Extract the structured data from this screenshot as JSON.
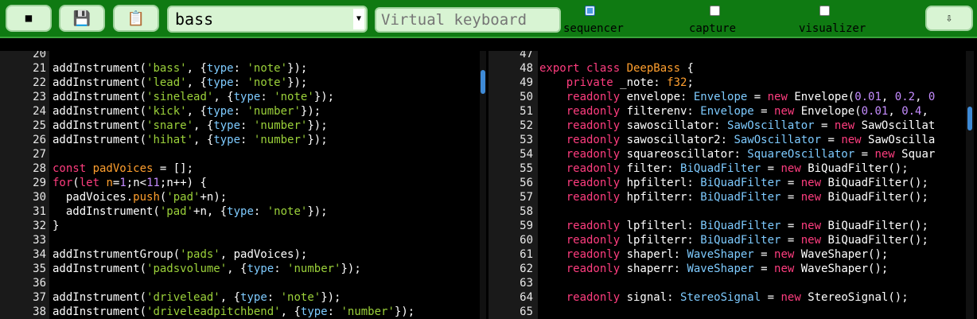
{
  "toolbar": {
    "stop_icon": "■",
    "save_icon": "💾",
    "copy_icon": "📋",
    "instrument_selected": "bass",
    "virtual_keyboard_placeholder": "Virtual keyboard",
    "checkboxes": [
      {
        "label": "sequencer",
        "checked": true
      },
      {
        "label": "capture",
        "checked": false
      },
      {
        "label": "visualizer",
        "checked": false
      }
    ],
    "download_icon": "⇩"
  },
  "left_code": [
    {
      "n": "20",
      "t": []
    },
    {
      "n": "21",
      "t": [
        [
          "t",
          "addInstrument("
        ],
        [
          "s",
          "'bass'"
        ],
        [
          "t",
          ", {"
        ],
        [
          "p",
          "type"
        ],
        [
          "t",
          ": "
        ],
        [
          "s",
          "'note'"
        ],
        [
          "t",
          "});"
        ]
      ]
    },
    {
      "n": "22",
      "t": [
        [
          "t",
          "addInstrument("
        ],
        [
          "s",
          "'lead'"
        ],
        [
          "t",
          ", {"
        ],
        [
          "p",
          "type"
        ],
        [
          "t",
          ": "
        ],
        [
          "s",
          "'note'"
        ],
        [
          "t",
          "});"
        ]
      ]
    },
    {
      "n": "23",
      "t": [
        [
          "t",
          "addInstrument("
        ],
        [
          "s",
          "'sinelead'"
        ],
        [
          "t",
          ", {"
        ],
        [
          "p",
          "type"
        ],
        [
          "t",
          ": "
        ],
        [
          "s",
          "'note'"
        ],
        [
          "t",
          "});"
        ]
      ]
    },
    {
      "n": "24",
      "t": [
        [
          "t",
          "addInstrument("
        ],
        [
          "s",
          "'kick'"
        ],
        [
          "t",
          ", {"
        ],
        [
          "p",
          "type"
        ],
        [
          "t",
          ": "
        ],
        [
          "s",
          "'number'"
        ],
        [
          "t",
          "});"
        ]
      ]
    },
    {
      "n": "25",
      "t": [
        [
          "t",
          "addInstrument("
        ],
        [
          "s",
          "'snare'"
        ],
        [
          "t",
          ", {"
        ],
        [
          "p",
          "type"
        ],
        [
          "t",
          ": "
        ],
        [
          "s",
          "'number'"
        ],
        [
          "t",
          "});"
        ]
      ]
    },
    {
      "n": "26",
      "t": [
        [
          "t",
          "addInstrument("
        ],
        [
          "s",
          "'hihat'"
        ],
        [
          "t",
          ", {"
        ],
        [
          "p",
          "type"
        ],
        [
          "t",
          ": "
        ],
        [
          "s",
          "'number'"
        ],
        [
          "t",
          "});"
        ]
      ]
    },
    {
      "n": "27",
      "t": []
    },
    {
      "n": "28",
      "t": [
        [
          "k",
          "const "
        ],
        [
          "c",
          "padVoices"
        ],
        [
          "t",
          " = [];"
        ]
      ]
    },
    {
      "n": "29",
      "t": [
        [
          "k",
          "for"
        ],
        [
          "t",
          "("
        ],
        [
          "k",
          "let "
        ],
        [
          "c",
          "n"
        ],
        [
          "t",
          "="
        ],
        [
          "n",
          "1"
        ],
        [
          "t",
          ";n<"
        ],
        [
          "n",
          "11"
        ],
        [
          "t",
          ";n++) {"
        ]
      ]
    },
    {
      "n": "30",
      "t": [
        [
          "t",
          "  padVoices."
        ],
        [
          "c",
          "push"
        ],
        [
          "t",
          "("
        ],
        [
          "s",
          "'pad'"
        ],
        [
          "t",
          "+n);"
        ]
      ]
    },
    {
      "n": "31",
      "t": [
        [
          "t",
          "  addInstrument("
        ],
        [
          "s",
          "'pad'"
        ],
        [
          "t",
          "+n, {"
        ],
        [
          "p",
          "type"
        ],
        [
          "t",
          ": "
        ],
        [
          "s",
          "'note'"
        ],
        [
          "t",
          "});"
        ]
      ]
    },
    {
      "n": "32",
      "t": [
        [
          "t",
          "}"
        ]
      ]
    },
    {
      "n": "33",
      "t": []
    },
    {
      "n": "34",
      "t": [
        [
          "t",
          "addInstrumentGroup("
        ],
        [
          "s",
          "'pads'"
        ],
        [
          "t",
          ", padVoices);"
        ]
      ]
    },
    {
      "n": "35",
      "t": [
        [
          "t",
          "addInstrument("
        ],
        [
          "s",
          "'padsvolume'"
        ],
        [
          "t",
          ", {"
        ],
        [
          "p",
          "type"
        ],
        [
          "t",
          ": "
        ],
        [
          "s",
          "'number'"
        ],
        [
          "t",
          "});"
        ]
      ]
    },
    {
      "n": "36",
      "t": []
    },
    {
      "n": "37",
      "t": [
        [
          "t",
          "addInstrument("
        ],
        [
          "s",
          "'drivelead'"
        ],
        [
          "t",
          ", {"
        ],
        [
          "p",
          "type"
        ],
        [
          "t",
          ": "
        ],
        [
          "s",
          "'note'"
        ],
        [
          "t",
          "});"
        ]
      ]
    },
    {
      "n": "38",
      "t": [
        [
          "t",
          "addInstrument("
        ],
        [
          "s",
          "'driveleadpitchbend'"
        ],
        [
          "t",
          ", {"
        ],
        [
          "p",
          "type"
        ],
        [
          "t",
          ": "
        ],
        [
          "s",
          "'number'"
        ],
        [
          "t",
          "});"
        ]
      ]
    }
  ],
  "right_code": [
    {
      "n": "47",
      "t": []
    },
    {
      "n": "48",
      "t": [
        [
          "k",
          "export class "
        ],
        [
          "c",
          "DeepBass"
        ],
        [
          "t",
          " {"
        ]
      ]
    },
    {
      "n": "49",
      "t": [
        [
          "k",
          "    private "
        ],
        [
          "t",
          "_note: "
        ],
        [
          "c",
          "f32"
        ],
        [
          "t",
          ";"
        ]
      ]
    },
    {
      "n": "50",
      "t": [
        [
          "k",
          "    readonly "
        ],
        [
          "t",
          "envelope: "
        ],
        [
          "p",
          "Envelope"
        ],
        [
          "t",
          " = "
        ],
        [
          "k",
          "new "
        ],
        [
          "t",
          "Envelope("
        ],
        [
          "n",
          "0.01"
        ],
        [
          "t",
          ", "
        ],
        [
          "n",
          "0.2"
        ],
        [
          "t",
          ", "
        ],
        [
          "n",
          "0"
        ]
      ]
    },
    {
      "n": "51",
      "t": [
        [
          "k",
          "    readonly "
        ],
        [
          "t",
          "filterenv: "
        ],
        [
          "p",
          "Envelope"
        ],
        [
          "t",
          " = "
        ],
        [
          "k",
          "new "
        ],
        [
          "t",
          "Envelope("
        ],
        [
          "n",
          "0.01"
        ],
        [
          "t",
          ", "
        ],
        [
          "n",
          "0.4"
        ],
        [
          "t",
          ","
        ]
      ]
    },
    {
      "n": "52",
      "t": [
        [
          "k",
          "    readonly "
        ],
        [
          "t",
          "sawoscillator: "
        ],
        [
          "p",
          "SawOscillator"
        ],
        [
          "t",
          " = "
        ],
        [
          "k",
          "new "
        ],
        [
          "t",
          "SawOscillat"
        ]
      ]
    },
    {
      "n": "53",
      "t": [
        [
          "k",
          "    readonly "
        ],
        [
          "t",
          "sawoscillator2: "
        ],
        [
          "p",
          "SawOscillator"
        ],
        [
          "t",
          " = "
        ],
        [
          "k",
          "new "
        ],
        [
          "t",
          "SawOscilla"
        ]
      ]
    },
    {
      "n": "54",
      "t": [
        [
          "k",
          "    readonly "
        ],
        [
          "t",
          "squareoscillator: "
        ],
        [
          "p",
          "SquareOscillator"
        ],
        [
          "t",
          " = "
        ],
        [
          "k",
          "new "
        ],
        [
          "t",
          "Squar"
        ]
      ]
    },
    {
      "n": "55",
      "t": [
        [
          "k",
          "    readonly "
        ],
        [
          "t",
          "filter: "
        ],
        [
          "p",
          "BiQuadFilter"
        ],
        [
          "t",
          " = "
        ],
        [
          "k",
          "new "
        ],
        [
          "t",
          "BiQuadFilter();"
        ]
      ]
    },
    {
      "n": "56",
      "t": [
        [
          "k",
          "    readonly "
        ],
        [
          "t",
          "hpfilterl: "
        ],
        [
          "p",
          "BiQuadFilter"
        ],
        [
          "t",
          " = "
        ],
        [
          "k",
          "new "
        ],
        [
          "t",
          "BiQuadFilter();"
        ]
      ]
    },
    {
      "n": "57",
      "t": [
        [
          "k",
          "    readonly "
        ],
        [
          "t",
          "hpfilterr: "
        ],
        [
          "p",
          "BiQuadFilter"
        ],
        [
          "t",
          " = "
        ],
        [
          "k",
          "new "
        ],
        [
          "t",
          "BiQuadFilter();"
        ]
      ]
    },
    {
      "n": "58",
      "t": []
    },
    {
      "n": "59",
      "t": [
        [
          "k",
          "    readonly "
        ],
        [
          "t",
          "lpfilterl: "
        ],
        [
          "p",
          "BiQuadFilter"
        ],
        [
          "t",
          " = "
        ],
        [
          "k",
          "new "
        ],
        [
          "t",
          "BiQuadFilter();"
        ]
      ]
    },
    {
      "n": "60",
      "t": [
        [
          "k",
          "    readonly "
        ],
        [
          "t",
          "lpfilterr: "
        ],
        [
          "p",
          "BiQuadFilter"
        ],
        [
          "t",
          " = "
        ],
        [
          "k",
          "new "
        ],
        [
          "t",
          "BiQuadFilter();"
        ]
      ]
    },
    {
      "n": "61",
      "t": [
        [
          "k",
          "    readonly "
        ],
        [
          "t",
          "shaperl: "
        ],
        [
          "p",
          "WaveShaper"
        ],
        [
          "t",
          " = "
        ],
        [
          "k",
          "new "
        ],
        [
          "t",
          "WaveShaper();"
        ]
      ]
    },
    {
      "n": "62",
      "t": [
        [
          "k",
          "    readonly "
        ],
        [
          "t",
          "shaperr: "
        ],
        [
          "p",
          "WaveShaper"
        ],
        [
          "t",
          " = "
        ],
        [
          "k",
          "new "
        ],
        [
          "t",
          "WaveShaper();"
        ]
      ]
    },
    {
      "n": "63",
      "t": []
    },
    {
      "n": "64",
      "t": [
        [
          "k",
          "    readonly "
        ],
        [
          "t",
          "signal: "
        ],
        [
          "p",
          "StereoSignal"
        ],
        [
          "t",
          " = "
        ],
        [
          "k",
          "new "
        ],
        [
          "t",
          "StereoSignal();"
        ]
      ]
    },
    {
      "n": "65",
      "t": []
    }
  ]
}
